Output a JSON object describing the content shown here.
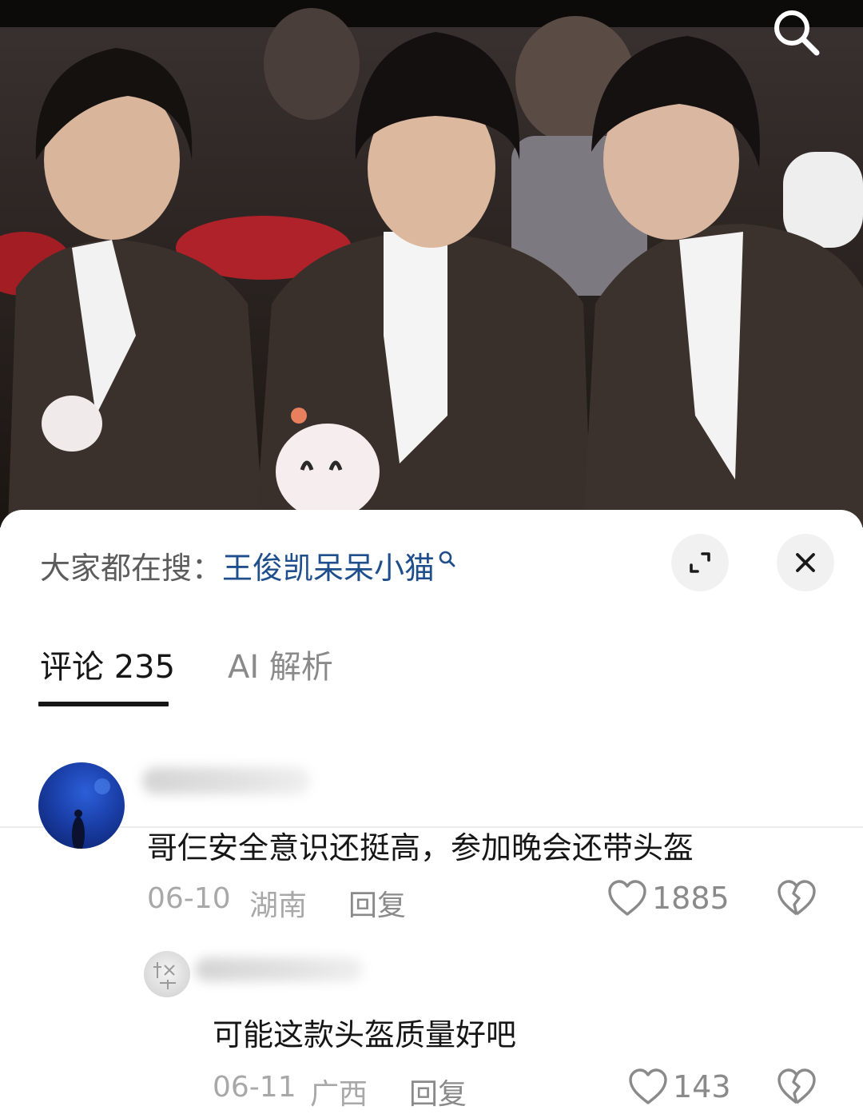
{
  "video": {
    "search_icon": "search-icon"
  },
  "hot_search": {
    "prefix": "大家都在搜：",
    "term": "王俊凯呆呆小猫",
    "term_icon": "magnifier-icon",
    "term_color": "#1f4e8c"
  },
  "sheet_buttons": {
    "expand_icon": "expand-icon",
    "close_icon": "close-icon"
  },
  "tabs": [
    {
      "label": "评论 235",
      "active": true
    },
    {
      "label": "AI 解析",
      "active": false
    }
  ],
  "comments": [
    {
      "text": "哥仨安全意识还挺高，参加晚会还带头盔",
      "date": "06-10",
      "location": "湖南",
      "reply_label": "回复",
      "likes": "1885",
      "replies": [
        {
          "text": "可能这款头盔质量好吧",
          "date": "06-11",
          "location": "广西",
          "reply_label": "回复",
          "likes": "143"
        }
      ]
    }
  ],
  "colors": {
    "text_primary": "#161616",
    "text_secondary": "#8a8a8a",
    "text_meta": "#a8a8a8",
    "accent_link": "#1f4e8c"
  }
}
